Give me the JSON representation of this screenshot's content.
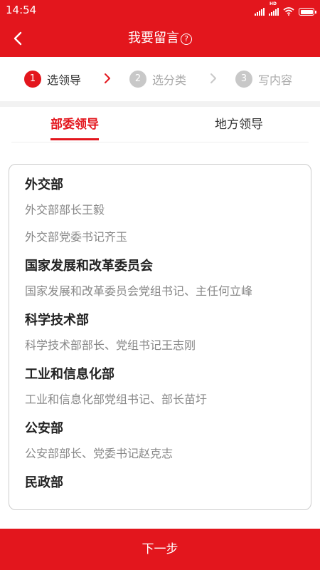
{
  "status_bar": {
    "time": "14:54",
    "hd_label": "HD"
  },
  "header": {
    "title": "我要留言",
    "help_glyph": "?"
  },
  "steps": [
    {
      "number": "1",
      "label": "选领导"
    },
    {
      "number": "2",
      "label": "选分类"
    },
    {
      "number": "3",
      "label": "写内容"
    }
  ],
  "tabs": [
    {
      "label": "部委领导"
    },
    {
      "label": "地方领导"
    }
  ],
  "departments": [
    {
      "name": "外交部",
      "leaders": [
        "外交部部长王毅",
        "外交部党委书记齐玉"
      ]
    },
    {
      "name": "国家发展和改革委员会",
      "leaders": [
        "国家发展和改革委员会党组书记、主任何立峰"
      ]
    },
    {
      "name": "科学技术部",
      "leaders": [
        "科学技术部部长、党组书记王志刚"
      ]
    },
    {
      "name": "工业和信息化部",
      "leaders": [
        "工业和信息化部党组书记、部长苗圩"
      ]
    },
    {
      "name": "公安部",
      "leaders": [
        "公安部部长、党委书记赵克志"
      ]
    },
    {
      "name": "民政部",
      "leaders": []
    }
  ],
  "bottom": {
    "next_label": "下一步"
  },
  "colors": {
    "brand_red": "#e3161d",
    "inactive_gray": "#c8c8c8",
    "muted_text": "#888888"
  },
  "icons": {
    "back": "back-arrow-icon",
    "help": "help-circle-icon",
    "step_separator": "chevron-right-icon"
  }
}
